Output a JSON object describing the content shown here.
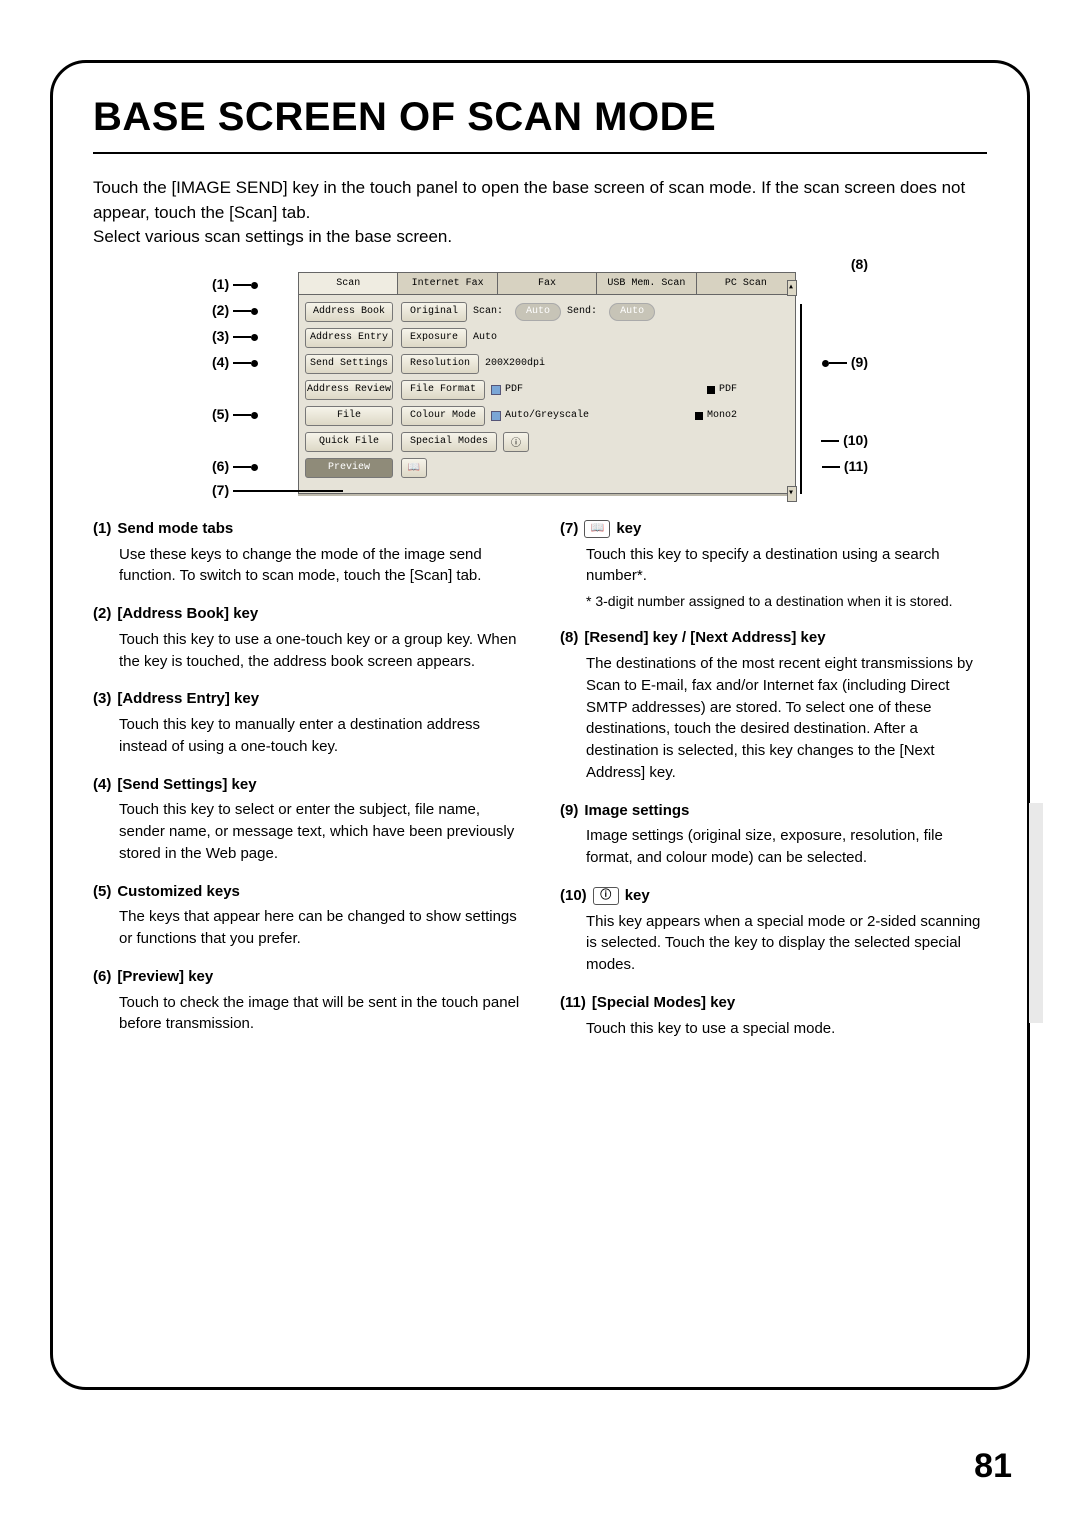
{
  "title": "BASE SCREEN OF SCAN MODE",
  "intro": "Touch the [IMAGE SEND] key in the touch panel to open the base screen of scan mode. If the scan screen does not appear, touch the [Scan] tab.\nSelect various scan settings in the base screen.",
  "page_number": "81",
  "callouts": {
    "c1": "(1)",
    "c2": "(2)",
    "c3": "(3)",
    "c4": "(4)",
    "c5": "(5)",
    "c6": "(6)",
    "c7": "(7)",
    "c8": "(8)",
    "c9": "(9)",
    "c10": "(10)",
    "c11": "(11)"
  },
  "screen": {
    "tabs": [
      "Scan",
      "Internet Fax",
      "Fax",
      "USB Mem. Scan",
      "PC Scan"
    ],
    "side_buttons": [
      "Address Book",
      "Address Entry",
      "Send Settings",
      "Address Review",
      "File",
      "Quick File"
    ],
    "preview": "Preview",
    "rows": {
      "original": {
        "btn": "Original",
        "scan_label": "Scan:",
        "scan_val": "Auto",
        "send_label": "Send:",
        "send_val": "Auto"
      },
      "exposure": {
        "btn": "Exposure",
        "val": "Auto"
      },
      "resolution": {
        "btn": "Resolution",
        "val": "200X200dpi"
      },
      "file_format": {
        "btn": "File Format",
        "left": "PDF",
        "right": "PDF"
      },
      "colour_mode": {
        "btn": "Colour Mode",
        "left": "Auto/Greyscale",
        "right": "Mono2"
      },
      "special_modes": {
        "btn": "Special Modes"
      }
    }
  },
  "items_left": [
    {
      "num": "(1)",
      "title": "Send mode tabs",
      "body": "Use these keys to change the mode of the image send function. To switch to scan mode, touch the [Scan] tab."
    },
    {
      "num": "(2)",
      "title": "[Address Book] key",
      "body": "Touch this key to use a one-touch key or a group key. When the key is touched, the address book screen appears."
    },
    {
      "num": "(3)",
      "title": "[Address Entry] key",
      "body": "Touch this key to manually enter a destination address instead of using a one-touch key."
    },
    {
      "num": "(4)",
      "title": "[Send Settings] key",
      "body": "Touch this key to select or enter the subject, file name, sender name, or message text, which have been previously stored in the Web page."
    },
    {
      "num": "(5)",
      "title": "Customized keys",
      "body": "The keys that appear here can be changed to show settings or functions that you prefer."
    },
    {
      "num": "(6)",
      "title": "[Preview] key",
      "body": "Touch to check the image that will be sent in the touch panel before transmission."
    }
  ],
  "items_right": [
    {
      "num": "(7)",
      "title_suffix": " key",
      "body": "Touch this key to specify a destination using a search number*.",
      "foot": "* 3-digit number assigned to a destination when it is stored."
    },
    {
      "num": "(8)",
      "title": "[Resend] key / [Next Address] key",
      "body": "The destinations of the most recent eight transmissions by Scan to E-mail, fax and/or Internet fax (including Direct SMTP addresses) are stored. To select one of these destinations, touch the desired destination. After a destination is selected, this key changes to the [Next Address] key."
    },
    {
      "num": "(9)",
      "title": "Image settings",
      "body": "Image settings (original size, exposure, resolution, file format, and colour mode) can be selected."
    },
    {
      "num": "(10)",
      "title_suffix": " key",
      "body": "This key appears when a special mode or 2-sided scanning is selected. Touch the key to display the selected special modes."
    },
    {
      "num": "(11)",
      "title": "[Special Modes] key",
      "body": "Touch this key to use a special mode."
    }
  ]
}
